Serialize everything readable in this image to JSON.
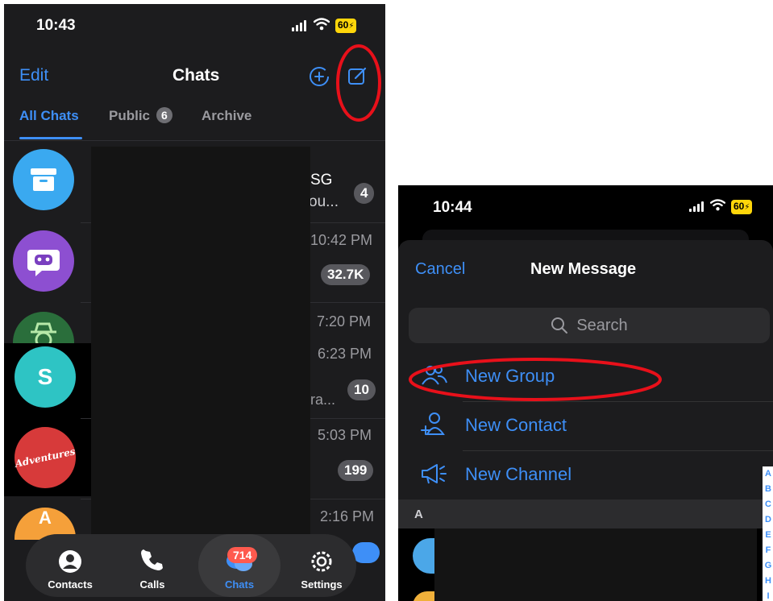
{
  "left_screen": {
    "status": {
      "time": "10:43",
      "battery": "60"
    },
    "header": {
      "edit_label": "Edit",
      "title": "Chats"
    },
    "tabs": [
      {
        "label": "All Chats"
      },
      {
        "label": "Public",
        "count": "6"
      },
      {
        "label": "Archive"
      }
    ],
    "chat_rows": [
      {
        "right_text_1": "SG",
        "right_text_2": "ou...",
        "badge": "4"
      },
      {
        "time": "10:42 PM",
        "badge": "32.7K"
      },
      {
        "time": "7:20 PM"
      },
      {
        "avatar_letter": "S",
        "time": "6:23 PM",
        "badge": "10",
        "snippet_end": "ra..."
      },
      {
        "time": "5:03 PM",
        "badge": "199",
        "avatar_text": "Adventures"
      },
      {
        "avatar_letter": "A",
        "time": "2:16 PM"
      }
    ],
    "tabbar": [
      {
        "label": "Contacts"
      },
      {
        "label": "Calls"
      },
      {
        "label": "Chats",
        "badge": "714"
      },
      {
        "label": "Settings"
      }
    ]
  },
  "right_screen": {
    "status": {
      "time": "10:44",
      "battery": "60"
    },
    "header": {
      "cancel_label": "Cancel",
      "title": "New Message"
    },
    "search": {
      "placeholder": "Search"
    },
    "menu": [
      {
        "label": "New Group",
        "icon": "group-icon"
      },
      {
        "label": "New Contact",
        "icon": "add-contact-icon"
      },
      {
        "label": "New Channel",
        "icon": "megaphone-icon"
      }
    ],
    "section_header": "A",
    "index_letters": [
      "A",
      "B",
      "C",
      "D",
      "E",
      "F",
      "G",
      "H",
      "I"
    ]
  },
  "colors": {
    "accent": "#3e8ff7",
    "annotation": "#e8101a",
    "badge_red": "#ff5a4e",
    "battery": "#ffd60a"
  }
}
